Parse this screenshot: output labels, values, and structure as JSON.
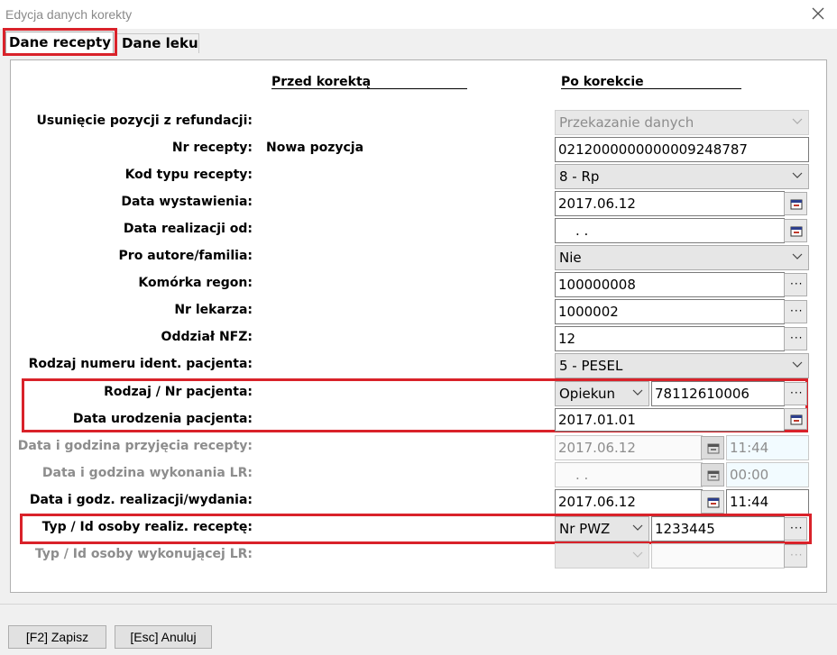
{
  "window": {
    "title": "Edycja danych korekty"
  },
  "tabs": [
    {
      "label": "Dane recepty"
    },
    {
      "label": "Dane leku"
    }
  ],
  "headers": {
    "before": "Przed korektą",
    "after": "Po korekcie"
  },
  "rows": {
    "usuniecie": {
      "label": "Usunięcie pozycji z refundacji:",
      "value": "Przekazanie danych"
    },
    "nr_recepty": {
      "label": "Nr recepty:",
      "before": "Nowa pozycja",
      "value": "0212000000000009248787"
    },
    "kod_typu": {
      "label": "Kod typu recepty:",
      "value": "8 - Rp"
    },
    "data_wystawienia": {
      "label": "Data wystawienia:",
      "value": "2017.06.12"
    },
    "data_realizacji_od": {
      "label": "Data realizacji od:",
      "value": ". ."
    },
    "pro_autore": {
      "label": "Pro autore/familia:",
      "value": "Nie"
    },
    "komorka_regon": {
      "label": "Komórka regon:",
      "value": "100000008"
    },
    "nr_lekarza": {
      "label": "Nr lekarza:",
      "value": "1000002"
    },
    "oddzial_nfz": {
      "label": "Oddział NFZ:",
      "value": "12"
    },
    "rodzaj_numeru": {
      "label": "Rodzaj numeru ident. pacjenta:",
      "value": "5 - PESEL"
    },
    "rodzaj_nr_pacjenta": {
      "label": "Rodzaj / Nr pacjenta:",
      "type": "Opiekun",
      "value": "78112610006"
    },
    "data_urodzenia": {
      "label": "Data urodzenia pacjenta:",
      "value": "2017.01.01"
    },
    "data_przyjecia": {
      "label": "Data i godzina przyjęcia recepty:",
      "date": "2017.06.12",
      "time": "11:44"
    },
    "data_wykonania": {
      "label": "Data i godzina wykonania LR:",
      "date": ". .",
      "time": "00:00"
    },
    "data_realizacji": {
      "label": "Data i godz. realizacji/wydania:",
      "date": "2017.06.12",
      "time": "11:44"
    },
    "typ_osoby_real": {
      "label": "Typ / Id osoby realiz. receptę:",
      "type": "Nr PWZ",
      "value": "1233445"
    },
    "typ_osoby_wyk": {
      "label": "Typ / Id osoby wykonującej LR:",
      "type": "",
      "value": ""
    }
  },
  "footer": {
    "save": "[F2] Zapisz",
    "cancel": "[Esc] Anuluj"
  },
  "colors": {
    "highlight": "#d9222a"
  }
}
